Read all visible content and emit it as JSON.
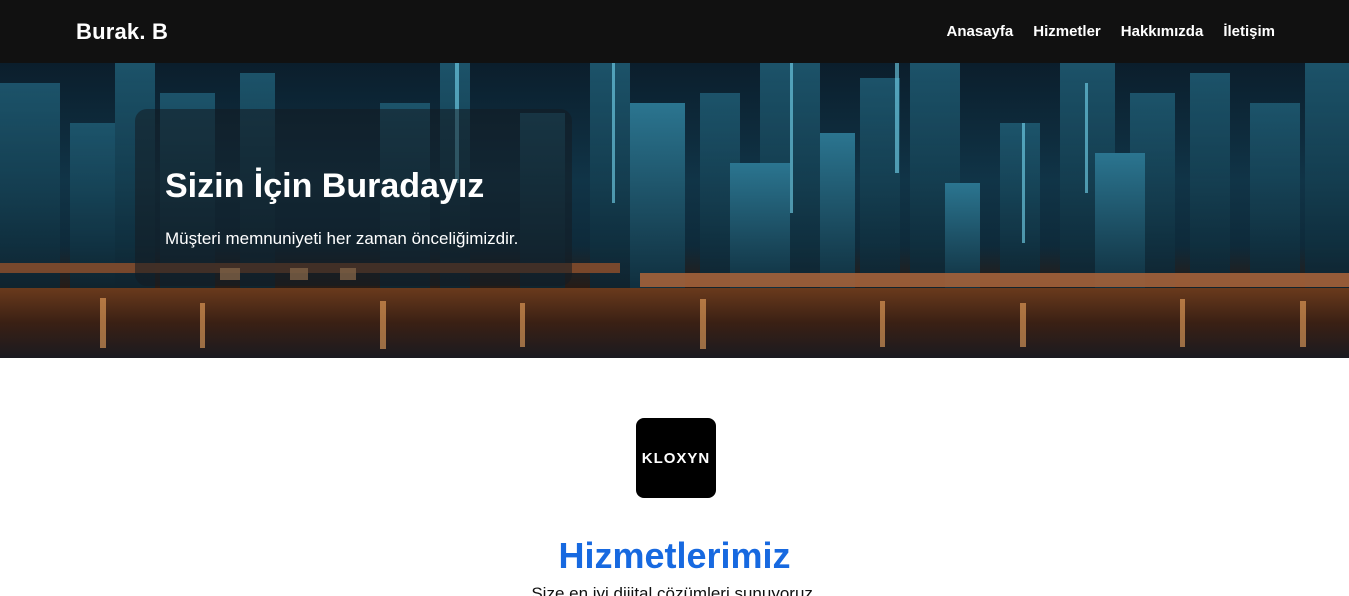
{
  "navbar": {
    "brand": "Burak. B",
    "links": [
      "Anasayfa",
      "Hizmetler",
      "Hakkımızda",
      "İletişim"
    ]
  },
  "hero": {
    "title": "Sizin İçin Buradayız",
    "text": "Müşteri memnuniyeti her zaman önceliğimizdir."
  },
  "logo": {
    "text": "KLOXYN"
  },
  "services": {
    "title": "Hizmetlerimiz",
    "subtitle": "Size en iyi dijital çözümleri sunuyoruz."
  },
  "colors": {
    "navbar": "#111111",
    "accent": "#1769e0",
    "logo_bg": "#000000"
  }
}
